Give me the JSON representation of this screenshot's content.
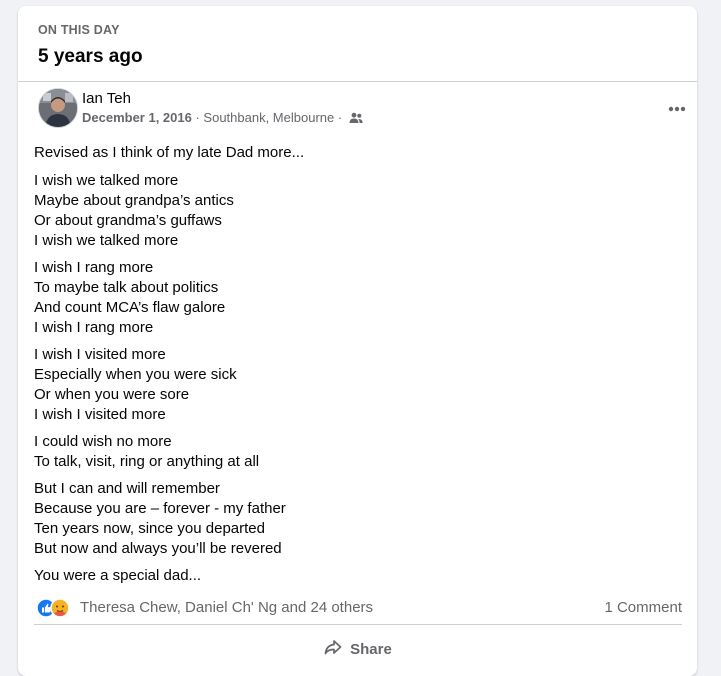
{
  "memory": {
    "kicker": "ON THIS DAY",
    "title": "5 years ago"
  },
  "post": {
    "author": "Ian Teh",
    "date": "December 1, 2016",
    "location_sep": " · ",
    "location": "Southbank, Melbourne",
    "audience_sep": " · ",
    "audience_icon": "friends-icon",
    "intro": "Revised as I think of my late Dad more...",
    "stanzas": [
      [
        "I wish we talked more",
        "Maybe about grandpa’s antics",
        "Or about grandma’s guffaws",
        "I wish we talked more"
      ],
      [
        "I wish I rang more",
        "To maybe talk about politics",
        "And count MCA’s flaw galore",
        "I wish I rang more"
      ],
      [
        "I wish I visited more",
        "Especially when you were sick",
        "Or when you were sore",
        "I wish I visited more"
      ],
      [
        "I could wish no more",
        "To talk, visit, ring or anything at all"
      ],
      [
        "But I can and will remember",
        "Because you are – forever - my father",
        "Ten years now, since you departed",
        "But now and always you’ll be revered"
      ]
    ],
    "closing": "You were a special dad..."
  },
  "reactions": {
    "icons": [
      "like-icon",
      "care-icon"
    ],
    "names": "Theresa Chew, Daniel Ch' Ng and 24 others",
    "comments": "1 Comment"
  },
  "actions": {
    "share_label": "Share",
    "more_icon": "more-options-icon"
  },
  "colors": {
    "background": "#f0f2f5",
    "card": "#ffffff",
    "secondary_text": "#65676b",
    "like_blue": "#1877f2",
    "care_yellow": "#f7b125"
  }
}
